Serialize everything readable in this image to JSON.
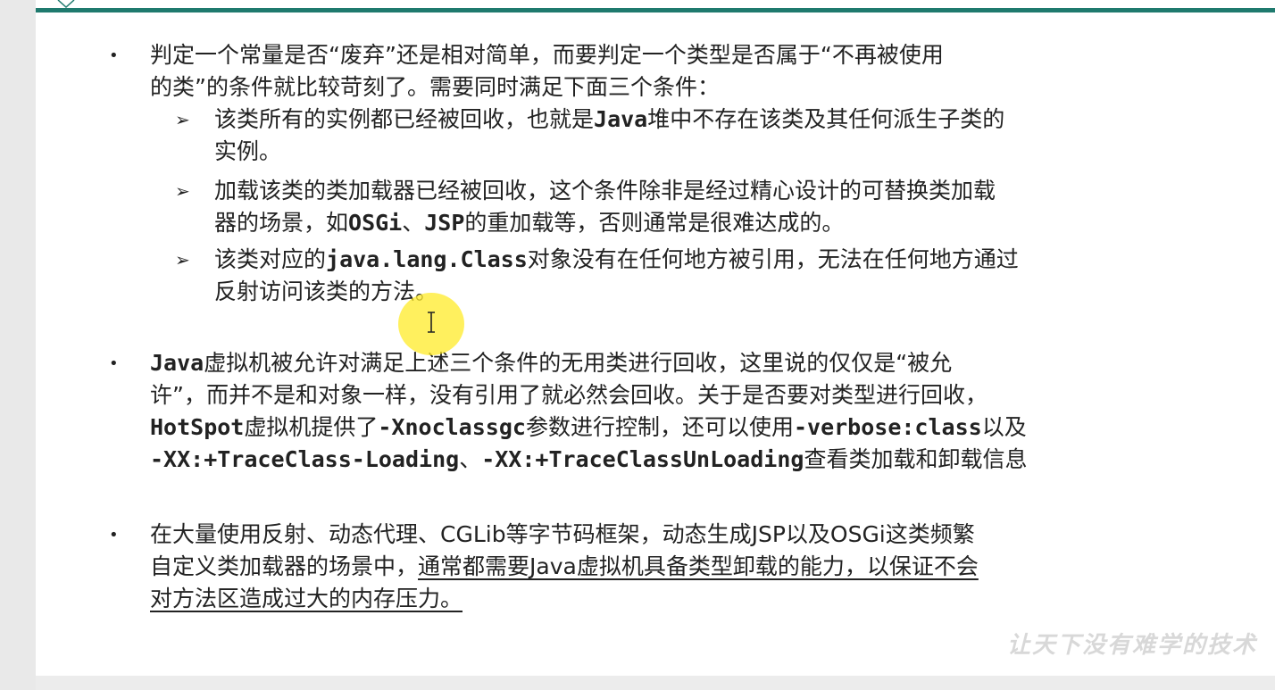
{
  "slide": {
    "bullets": [
      {
        "lines": [
          [
            {
              "t": "判定一个常量是否“废弃”还是相对简单，而要判定一个类型是否属于“不再被使用"
            }
          ],
          [
            {
              "t": "的类”的条件就比较苛刻了。需要同时满足下面三个条件："
            }
          ]
        ],
        "subitems": [
          {
            "lines": [
              [
                {
                  "t": "该类所有的实例都已经被回收，也就是"
                },
                {
                  "t": "Java",
                  "m": 1
                },
                {
                  "t": "堆中不存在该类及其任何派生子类的"
                }
              ],
              [
                {
                  "t": "实例。"
                }
              ]
            ]
          },
          {
            "lines": [
              [
                {
                  "t": "加载该类的类加载器已经被回收，这个条件除非是经过精心设计的可替换类加载"
                }
              ],
              [
                {
                  "t": "器的场景，如"
                },
                {
                  "t": "OSGi",
                  "m": 1
                },
                {
                  "t": "、"
                },
                {
                  "t": "JSP",
                  "m": 1
                },
                {
                  "t": "的重加载等，否则通常是很难达成的。"
                }
              ]
            ]
          },
          {
            "lines": [
              [
                {
                  "t": "该类对应的"
                },
                {
                  "t": "java.lang.Class",
                  "m": 1
                },
                {
                  "t": "对象没有在任何地方被引用，无法在任何地方通过"
                }
              ],
              [
                {
                  "t": "反射访问该类的方法。"
                }
              ]
            ]
          }
        ]
      },
      {
        "lines": [
          [
            {
              "t": "Java",
              "m": 1
            },
            {
              "t": "虚拟机被允许对满足上述三个条件的无用类进行回收，这里说的仅仅是“被允"
            }
          ],
          [
            {
              "t": "许”，而并不是和对象一样，没有引用了就必然会回收。关于是否要对类型进行回收，"
            }
          ],
          [
            {
              "t": "HotSpot",
              "m": 1
            },
            {
              "t": "虚拟机提供了"
            },
            {
              "t": "-Xnoclassgc",
              "m": 1
            },
            {
              "t": "参数进行控制，还可以使用"
            },
            {
              "t": "-verbose:class",
              "m": 1
            },
            {
              "t": "以及"
            }
          ],
          [
            {
              "t": "-XX:+TraceClass-Loading",
              "m": 1
            },
            {
              "t": "、"
            },
            {
              "t": "-XX:+TraceClassUnLoading",
              "m": 1
            },
            {
              "t": "查看类加载和卸载信息"
            }
          ]
        ]
      },
      {
        "lines": [
          [
            {
              "t": "在大量使用反射、动态代理、CGLib等字节码框架，动态生成JSP以及OSGi这类频繁"
            }
          ],
          [
            {
              "t": "自定义类加载器的场景中，"
            },
            {
              "t": "通常都需要Java虚拟机具备类型卸载的能力，以保证不会",
              "u": 1
            }
          ],
          [
            {
              "t": "对方法区造成过大的内存压力。",
              "u": 1
            }
          ]
        ]
      }
    ],
    "watermark": "让天下没有难学的技术",
    "colors": {
      "accent": "#1f7a6e",
      "text": "#222222",
      "cursor_highlight": "#ffeb28"
    },
    "icons": {
      "bullet": "bullet-dot-icon",
      "subbullet": "arrowhead-icon",
      "cursor": "text-cursor-icon"
    }
  }
}
